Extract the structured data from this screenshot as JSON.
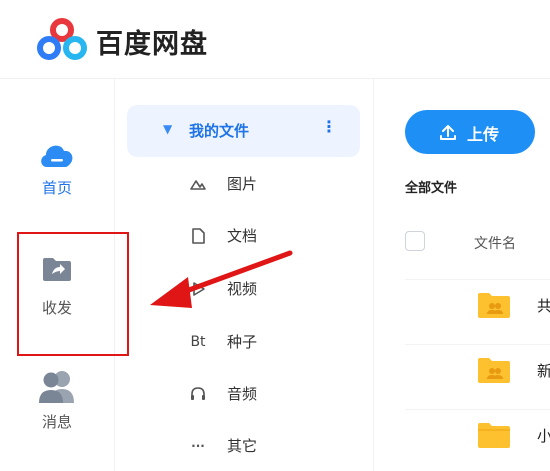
{
  "app": {
    "title": "百度网盘",
    "brand_color": "#1e8ff5"
  },
  "nav": {
    "items": [
      {
        "label": "首页",
        "icon": "cloud-icon",
        "color": "#1f73e8"
      },
      {
        "label": "收发",
        "icon": "share-folder-icon",
        "color": "#555555"
      },
      {
        "label": "消息",
        "icon": "users-icon",
        "color": "#555555"
      }
    ]
  },
  "tree": {
    "root": {
      "label": "我的文件",
      "more": "⋮"
    },
    "items": [
      {
        "label": "图片",
        "icon": "image-icon",
        "glyph": "⌂"
      },
      {
        "label": "文档",
        "icon": "document-icon",
        "glyph": ""
      },
      {
        "label": "视频",
        "icon": "video-icon",
        "glyph": ""
      },
      {
        "label": "种子",
        "icon": "bt-icon",
        "glyph": "Bt"
      },
      {
        "label": "音频",
        "icon": "headphones-icon",
        "glyph": ""
      },
      {
        "label": "其它",
        "icon": "more-icon",
        "glyph": "···"
      }
    ]
  },
  "main": {
    "upload_label": "上传",
    "section_title": "全部文件",
    "column_name": "文件名",
    "rows": [
      {
        "name": "共",
        "type": "shared-folder"
      },
      {
        "name": "新",
        "type": "shared-folder"
      },
      {
        "name": "小",
        "type": "folder"
      }
    ]
  },
  "annotation": {
    "box_color": "#e01616"
  }
}
